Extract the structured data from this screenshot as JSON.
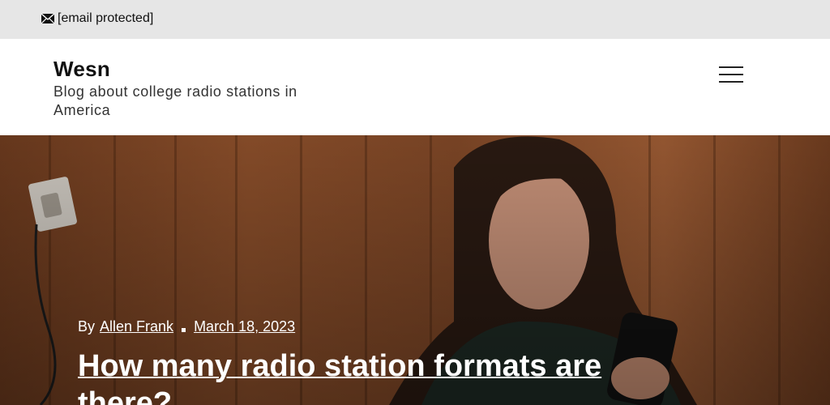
{
  "topbar": {
    "email_icon": "mail-icon",
    "email_text": "[email protected]"
  },
  "header": {
    "site_title": "Wesn",
    "tagline": "Blog about college radio stations in America",
    "menu_icon": "hamburger-menu-icon"
  },
  "hero": {
    "by_label": "By",
    "author": "Allen Frank",
    "date": "March 18, 2023",
    "post_title": "How many radio station formats are there?"
  },
  "colors": {
    "topbar_bg": "#e6e6e6",
    "hero_text": "#ffffff"
  }
}
